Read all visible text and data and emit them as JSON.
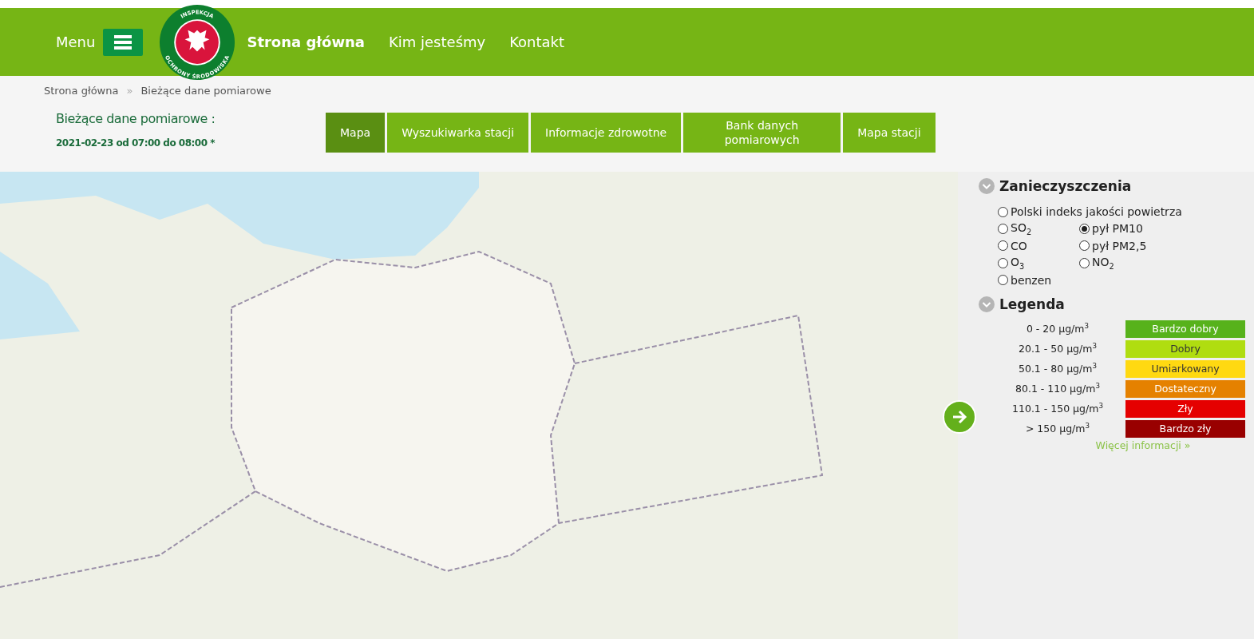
{
  "header": {
    "menu_label": "Menu",
    "logo_text_top": "INSPEKCJA",
    "logo_text_bottom": "OCHRONY ŚRODOWISKA",
    "nav": [
      {
        "label": "Strona główna",
        "selected": true
      },
      {
        "label": "Kim jesteśmy",
        "selected": false
      },
      {
        "label": "Kontakt",
        "selected": false
      }
    ]
  },
  "breadcrumb": [
    "Strona główna",
    "Bieżące dane pomiarowe"
  ],
  "breadcrumb_separator": "»",
  "page_title": "Bieżące dane pomiarowe :",
  "period": "2021-02-23 od 07:00 do 08:00 *",
  "tabs": [
    {
      "label": "Mapa",
      "selected": true
    },
    {
      "label": "Wyszukiwarka stacji",
      "selected": false
    },
    {
      "label": "Informacje zdrowotne",
      "selected": false
    },
    {
      "label": "Bank danych pomiarowych",
      "selected": false
    },
    {
      "label": "Mapa stacji",
      "selected": false
    }
  ],
  "pollutants": {
    "title": "Zanieczyszczenia",
    "options": [
      {
        "label": "Polski indeks jakości powietrza",
        "selected": false
      },
      {
        "label": "SO$_{2}$",
        "selected": false
      },
      {
        "label": "pył PM10",
        "selected": true
      },
      {
        "label": "CO",
        "selected": false
      },
      {
        "label": "pył PM2,5",
        "selected": false
      },
      {
        "label": "O$_{3}$",
        "selected": false
      },
      {
        "label": "NO$_{2}$",
        "selected": false
      },
      {
        "label": "benzen",
        "selected": false
      }
    ]
  },
  "legend": {
    "title": "Legenda",
    "rows": [
      {
        "range": "0 - 20 µg/m$^{3}$",
        "label": "Bardzo dobry",
        "color": "#57b21b"
      },
      {
        "range": "20.1 - 50 µg/m$^{3}$",
        "label": "Dobry",
        "color": "#b0dd10"
      },
      {
        "range": "50.1 - 80 µg/m$^{3}$",
        "label": "Umiarkowany",
        "color": "#ffd911"
      },
      {
        "range": "80.1 - 110 µg/m$^{3}$",
        "label": "Dostateczny",
        "color": "#e58100"
      },
      {
        "range": "110.1 - 150 µg/m$^{3}$",
        "label": "Zły",
        "color": "#e50000"
      },
      {
        "range": "> 150 µg/m$^{3}$",
        "label": "Bardzo zły",
        "color": "#990000"
      }
    ],
    "more_link": "Więcej informacji »"
  }
}
